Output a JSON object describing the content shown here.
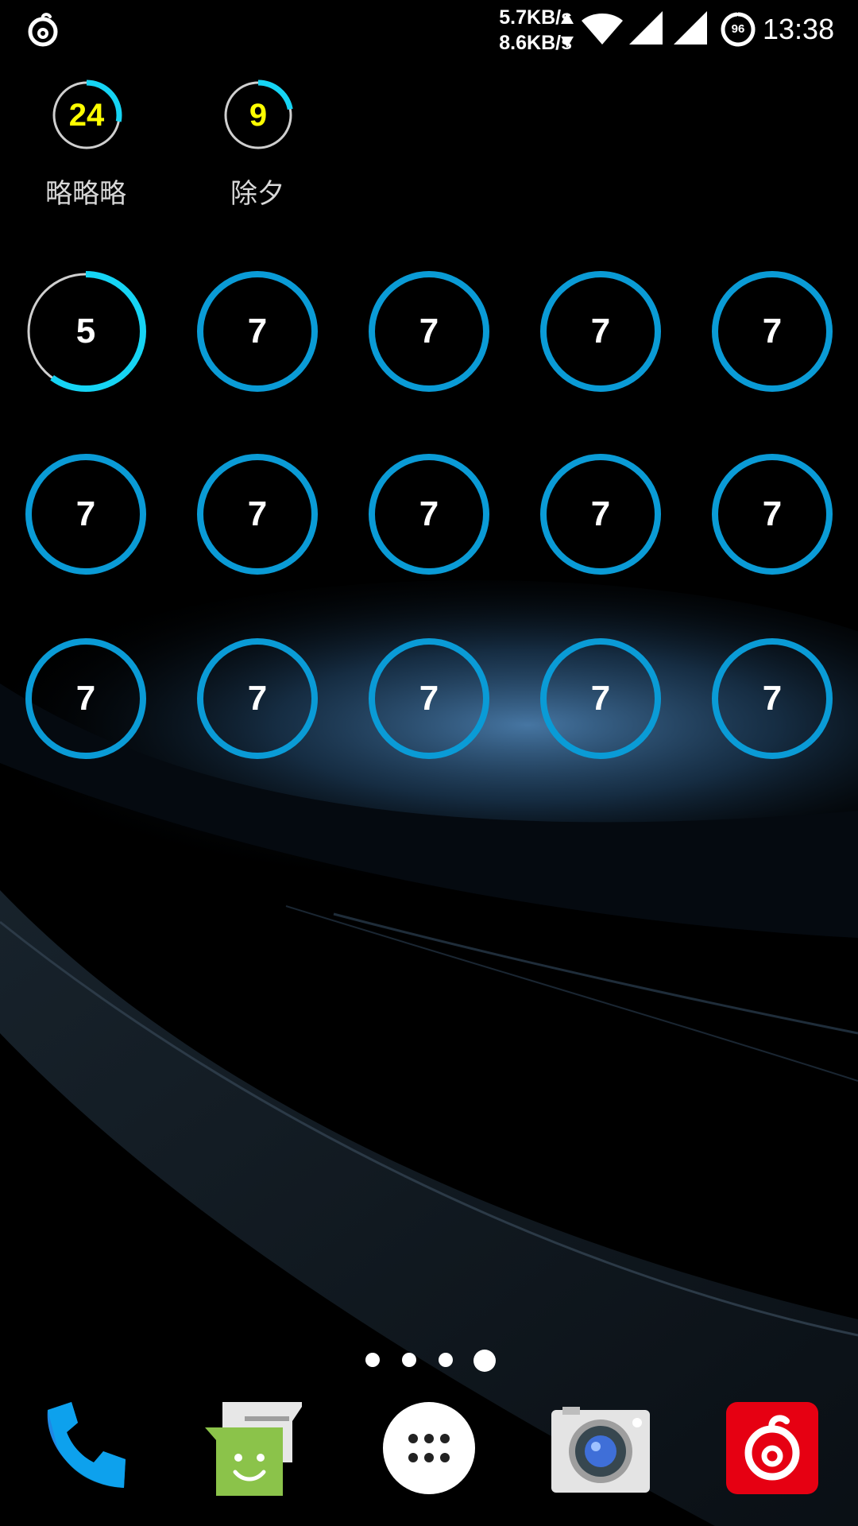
{
  "status_bar": {
    "net_up": "5.7KB/s",
    "net_down": "8.6KB/s",
    "battery_level": "96",
    "time": "13:38",
    "app_notification_icon": "netease-music-icon"
  },
  "widgets": {
    "small": [
      {
        "count": "24",
        "label": "略略略",
        "progress": 0.28,
        "count_color": "#ffff00"
      },
      {
        "count": "9",
        "label": "除夕",
        "progress": 0.22,
        "count_color": "#ffff00"
      }
    ],
    "rings": {
      "row1": [
        {
          "num": "5",
          "progress": 0.6
        },
        {
          "num": "7",
          "progress": 1.0
        },
        {
          "num": "7",
          "progress": 1.0
        },
        {
          "num": "7",
          "progress": 1.0
        },
        {
          "num": "7",
          "progress": 1.0
        }
      ],
      "row2": [
        {
          "num": "7",
          "progress": 1.0
        },
        {
          "num": "7",
          "progress": 1.0
        },
        {
          "num": "7",
          "progress": 1.0
        },
        {
          "num": "7",
          "progress": 1.0
        },
        {
          "num": "7",
          "progress": 1.0
        }
      ],
      "row3": [
        {
          "num": "7",
          "progress": 1.0
        },
        {
          "num": "7",
          "progress": 1.0
        },
        {
          "num": "7",
          "progress": 1.0
        },
        {
          "num": "7",
          "progress": 1.0
        },
        {
          "num": "7",
          "progress": 1.0
        }
      ]
    }
  },
  "page_indicator": {
    "pages": 4,
    "current": 4
  },
  "dock": [
    {
      "icon": "phone-icon",
      "name": "Phone"
    },
    {
      "icon": "messaging-icon",
      "name": "Messaging"
    },
    {
      "icon": "app-drawer-icon",
      "name": "All apps"
    },
    {
      "icon": "camera-icon",
      "name": "Camera"
    },
    {
      "icon": "netease-music-icon",
      "name": "NetEase Cloud Music"
    }
  ],
  "colors": {
    "ring_blue": "#0a9bd6",
    "ring_cyan": "#16d4f4",
    "ring_track": "#cfcfcf",
    "count_yellow": "#ffff00",
    "netease_red": "#e60012",
    "messaging_green": "#8bc34a",
    "phone_blue": "#1e88e5"
  }
}
